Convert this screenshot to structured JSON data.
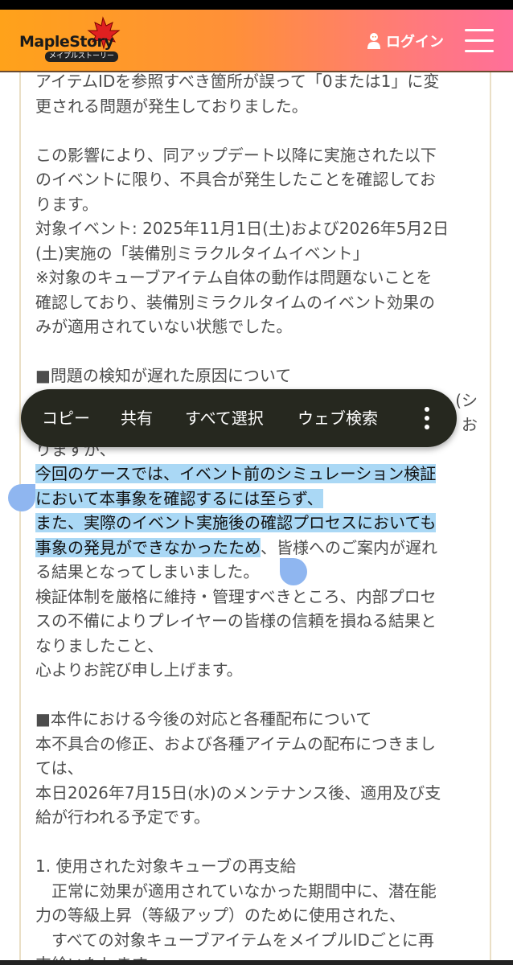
{
  "header": {
    "logo_text": "MapleStory",
    "logo_sub": "メイプルストーリー",
    "login_label": "ログイン",
    "colors": {
      "gradient_start": "#ffa21a",
      "gradient_end": "#ff6f9a"
    }
  },
  "article": {
    "lines": [
      "アイテムIDを参照すべき箇所が誤って「0または1」に変",
      "更される問題が発生しておりました。",
      "",
      "この影響により、同アップデート以降に実施された以下",
      "のイベントに限り、不具合が発生したことを確認してお",
      "ります。",
      "対象イベント: 2025年11月1日(土)および2026年5月2日",
      "(土)実施の「装備別ミラクルタイムイベント」",
      "※対象のキューブアイテム自体の動作は問題ないことを",
      "確認しており、装備別ミラクルタイムのイベント効果の",
      "みが適用されていない状態でした。",
      "",
      "■問題の検知が遅れた原因について",
      "",
      "",
      "りますが、"
    ],
    "hl1": "今回のケースでは、イベント前のシミュレーション検証",
    "hl2": "において本事象を確認するには至らず、",
    "hl3": "また、実際のイベント実施後の確認プロセスにおいても",
    "hl4": "事象の発見ができなかったため",
    "hl4_rest": "、皆様へのご案内が遅れ",
    "lines_after": [
      "る結果となってしまいました。",
      "検証体制を厳格に維持・管理すべきところ、内部プロセ",
      "スの不備によりプレイヤーの皆様の信頼を損ねる結果と",
      "なりましたこと、",
      "心よりお詫び申し上げます。",
      "",
      "■本件における今後の対応と各種配布について",
      "本不具合の修正、および各種アイテムの配布につきまし",
      "ては、",
      "本日2026年7月15日(水)のメンテナンス後、適用及び支",
      "給が行われる予定です。",
      "",
      "1. 使用された対象キューブの再支給",
      "　正常に効果が適用されていなかった期間中に、潜在能",
      "力の等級上昇（等級アップ）のために使用された、",
      "　すべての対象キューブアイテムをメイプルIDごとに再",
      "支給いたします。"
    ],
    "partial_right_1": "(シ",
    "partial_right_2": "お"
  },
  "context_menu": {
    "items": [
      "コピー",
      "共有",
      "すべて選択",
      "ウェブ検索"
    ]
  }
}
